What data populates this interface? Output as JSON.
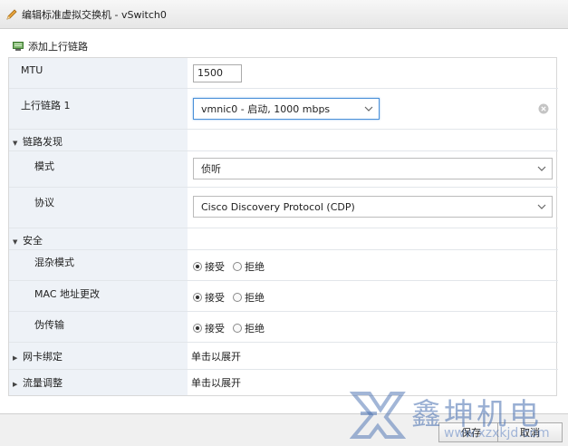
{
  "window": {
    "title": "编辑标准虚拟交换机 - vSwitch0"
  },
  "toolbar": {
    "add_uplink": "添加上行链路"
  },
  "mtu": {
    "label": "MTU",
    "value": "1500"
  },
  "uplink": {
    "label": "上行链路 1",
    "value": "vmnic0 - 启动, 1000 mbps"
  },
  "link_discovery": {
    "section": "链路发现",
    "mode_label": "模式",
    "mode_value": "侦听",
    "protocol_label": "协议",
    "protocol_value": "Cisco Discovery Protocol (CDP)"
  },
  "security": {
    "section": "安全",
    "accept": "接受",
    "reject": "拒绝",
    "rows": [
      {
        "label": "混杂模式",
        "selected": "accept"
      },
      {
        "label": "MAC 地址更改",
        "selected": "accept"
      },
      {
        "label": "伪传输",
        "selected": "accept"
      }
    ]
  },
  "nic_teaming": {
    "section": "网卡绑定",
    "value": "单击以展开"
  },
  "traffic_shaping": {
    "section": "流量调整",
    "value": "单击以展开"
  },
  "footer": {
    "save": "保存",
    "cancel": "取消"
  },
  "watermark": {
    "text": "鑫坤机电",
    "url": "www.xzxkjd.com"
  }
}
